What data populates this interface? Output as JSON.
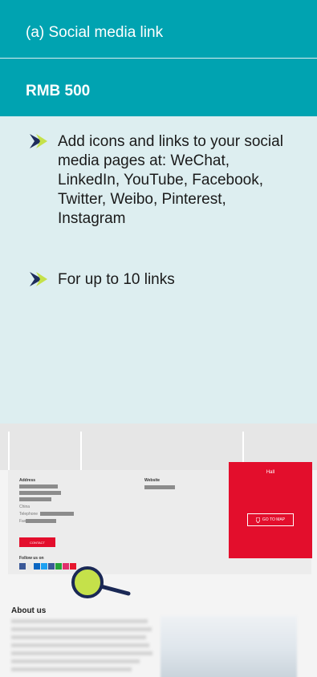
{
  "card": {
    "title": "(a) Social media link",
    "price": "RMB 500",
    "bullets": [
      "Add icons and links to your social media pages at: WeChat, LinkedIn, YouTube, Facebook, Twitter, Weibo, Pinterest, Instagram",
      "For up to 10 links"
    ]
  },
  "screenshot": {
    "address_label": "Address",
    "website_label": "Website",
    "city_label": "China",
    "telephone_label": "Telephone",
    "fax_label": "Fax",
    "contact_button": "CONTACT",
    "follow_label": "Follow us on",
    "hall_label": "Hall",
    "map_button": "GO TO MAP",
    "about_title": "About us"
  },
  "colors": {
    "teal": "#00a3b1",
    "card_bg": "#ddeef0",
    "red": "#e30e2c",
    "magnifier": "#c5e14a"
  },
  "icons": [
    "bullet-arrow-icon",
    "map-pin-icon",
    "magnifier-icon"
  ]
}
